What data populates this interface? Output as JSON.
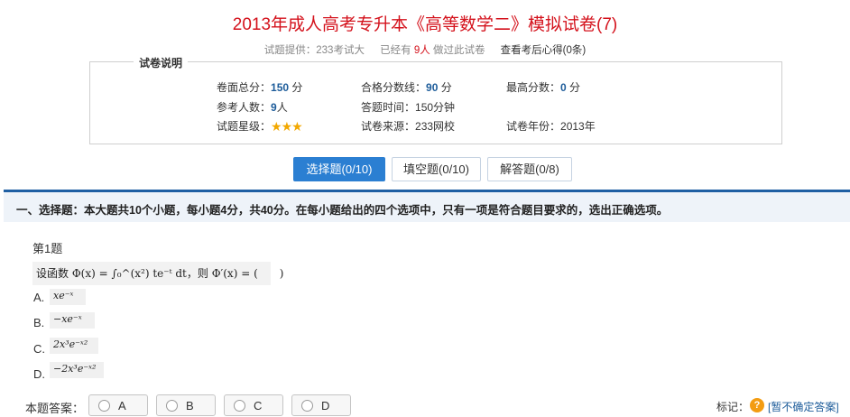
{
  "page": {
    "title": "2013年成人高考专升本《高等数学二》模拟试卷(7)",
    "provider_prefix": "试题提供：",
    "provider": "233考试大",
    "taken_prefix": "已经有",
    "taken_count": "9人",
    "taken_suffix": "做过此试卷",
    "review_link": "查看考后心得(0条)"
  },
  "info": {
    "legend": "试卷说明",
    "total_label": "卷面总分：",
    "total_value": "150",
    "total_unit": "分",
    "pass_label": "合格分数线：",
    "pass_value": "90",
    "pass_unit": "分",
    "max_label": "最高分数：",
    "max_value": "0",
    "max_unit": "分",
    "people_label": "参考人数：",
    "people_value": "9",
    "people_unit": "人",
    "time_label": "答题时间：",
    "time_value": "150分钟",
    "star_label": "试题星级：",
    "stars": "★★★",
    "star_count": 3,
    "source_label": "试卷来源：",
    "source_value": "233网校",
    "year_label": "试卷年份：",
    "year_value": "2013年"
  },
  "tabs": [
    {
      "label": "选择题(0/10)",
      "active": true
    },
    {
      "label": "填空题(0/10)",
      "active": false
    },
    {
      "label": "解答题(0/8)",
      "active": false
    }
  ],
  "section": {
    "text": "一、选择题：本大题共10个小题，每小题4分，共40分。在每小题给出的四个选项中，只有一项是符合题目要求的，选出正确选项。"
  },
  "question": {
    "number_label": "第1题",
    "stem": "设函数 Φ(x) = ∫₀^(x²) te⁻ᵗ dt，则 Φ′(x) = (　　)",
    "options": [
      {
        "letter": "A.",
        "formula": "xe⁻ˣ"
      },
      {
        "letter": "B.",
        "formula": "−xe⁻ˣ"
      },
      {
        "letter": "C.",
        "formula": "2x³e⁻ˣ²"
      },
      {
        "letter": "D.",
        "formula": "−2x³e⁻ˣ²"
      }
    ]
  },
  "answer": {
    "label": "本题答案：",
    "choices": [
      "A",
      "B",
      "C",
      "D"
    ],
    "mark_label": "标记：",
    "mark_icon": "question-icon",
    "mark_link": "[暂不确定答案]"
  },
  "colors": {
    "title_red": "#d4121c",
    "accent_blue": "#2b7fd2",
    "section_bar": "#1f5fa3",
    "star": "#f2a800"
  }
}
